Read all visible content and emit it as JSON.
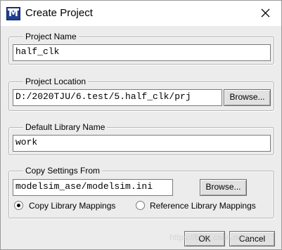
{
  "window": {
    "title": "Create Project",
    "app_icon_letter": "M"
  },
  "project_name": {
    "label": "Project Name",
    "value": "half_clk"
  },
  "project_location": {
    "label": "Project Location",
    "value": "D:/2020TJU/6.test/5.half_clk/prj",
    "browse_label": "Browse..."
  },
  "default_library": {
    "label": "Default Library Name",
    "value": "work"
  },
  "copy_settings": {
    "label": "Copy Settings From",
    "value": "modelsim_ase/modelsim.ini",
    "browse_label": "Browse...",
    "options": [
      {
        "label": "Copy Library Mappings",
        "selected": true
      },
      {
        "label": "Reference Library Mappings",
        "selected": false
      }
    ]
  },
  "buttons": {
    "ok": "OK",
    "cancel": "Cancel"
  },
  "watermark": "https://blog.csdn.net/..."
}
